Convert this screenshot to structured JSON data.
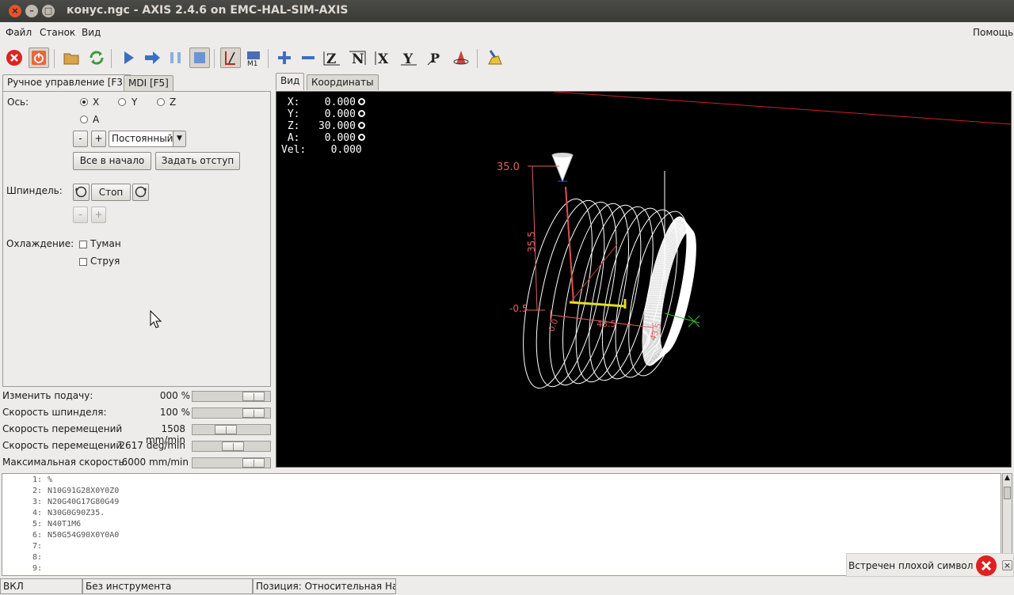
{
  "window": {
    "title": "конус.ngc - AXIS 2.4.6 on EMC-HAL-SIM-AXIS"
  },
  "menu": {
    "file": "Файл",
    "machine": "Станок",
    "view": "Вид",
    "help": "Помощь"
  },
  "toolbar": {
    "icons": [
      "estop-icon",
      "power-icon",
      "open-file-icon",
      "reload-icon",
      "run-icon",
      "step-icon",
      "pause-icon",
      "stop-icon",
      "block-delete-icon",
      "optional-stop-icon",
      "zoom-in-icon",
      "zoom-out-icon",
      "view-z-icon",
      "view-z2-icon",
      "view-x-icon",
      "view-y-icon",
      "view-p-icon",
      "rotate-icon",
      "clear-plot-icon"
    ]
  },
  "tabs_left": {
    "manual": "Ручное управление [F3]",
    "mdi": "MDI [F5]"
  },
  "manual": {
    "axis_label": "Ось:",
    "axes": [
      "X",
      "Y",
      "Z",
      "A"
    ],
    "selected_axis": "X",
    "minus": "-",
    "plus": "+",
    "jog_mode": "Постоянный",
    "home_all": "Все в начало",
    "touch_off": "Задать отступ",
    "spindle_label": "Шпиндель:",
    "spindle_stop": "Стоп",
    "coolant_label": "Охлаждение:",
    "mist": "Туман",
    "flood": "Струя"
  },
  "sliders": [
    {
      "label": "Изменить подачу:",
      "value": "000 %",
      "fraction": 0.9
    },
    {
      "label": "Скорость шпинделя:",
      "value": "100 %",
      "fraction": 0.9
    },
    {
      "label": "Скорость перемещений",
      "value": "1508 mm/min",
      "fraction": 0.4
    },
    {
      "label": "Скорость перемещений",
      "value": "2617 deg/min",
      "fraction": 0.53
    },
    {
      "label": "Максимальная скорость:",
      "value": "6000 mm/min",
      "fraction": 0.9
    }
  ],
  "tabs_right": {
    "view": "Вид",
    "coordinates": "Координаты"
  },
  "dro": {
    "x": " X:    0.000",
    "y": " Y:    0.000",
    "z": " Z:   30.000",
    "a": " A:    0.000",
    "vel": "Vel:    0.000"
  },
  "preview_labels": {
    "z_top": "35.0",
    "z_len": "35.5",
    "z_bottom": "-0.5",
    "x_left": "0.0",
    "x_len": "43.5",
    "x_right": "43.5"
  },
  "gcode": [
    {
      "n": "1:",
      "text": "%"
    },
    {
      "n": "2:",
      "text": "N10G91G28X0Y0Z0"
    },
    {
      "n": "3:",
      "text": "N20G40G17G80G49"
    },
    {
      "n": "4:",
      "text": "N30G0G90Z35."
    },
    {
      "n": "5:",
      "text": "N40T1M6"
    },
    {
      "n": "6:",
      "text": "N50G54G90X0Y0A0"
    },
    {
      "n": "7:",
      "text": ""
    },
    {
      "n": "8:",
      "text": ""
    },
    {
      "n": "9:",
      "text": ""
    }
  ],
  "error": {
    "message": "Встречен плохой символ 'с'",
    "close": "×"
  },
  "status": {
    "state": "ВКЛ",
    "tool": "Без инструмента",
    "position": "Позиция: Относительная Наст"
  },
  "colors": {
    "titlebar": "#3c3b37",
    "preview_bg": "#000000",
    "path": "#ffffff",
    "dim": "#e06060"
  }
}
